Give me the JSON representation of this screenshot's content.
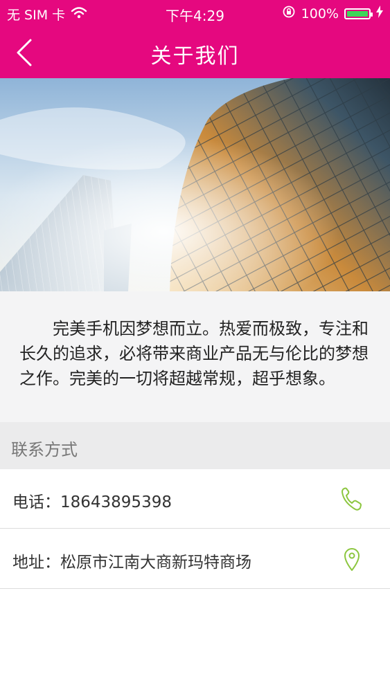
{
  "status_bar": {
    "carrier": "无 SIM 卡",
    "time": "下午4:29",
    "battery": "100%"
  },
  "nav": {
    "title": "关于我们"
  },
  "intro": {
    "text": "完美手机因梦想而立。热爱而极致，专注和长久的追求，必将带来商业产品无与伦比的梦想之作。完美的一切将超越常规，超乎想象。"
  },
  "contact": {
    "section_title": "联系方式",
    "phone_label": "电话：",
    "phone": "18643895398",
    "address_label": "地址：",
    "address": "松原市江南大商新玛特商场"
  },
  "colors": {
    "brand": "#e5087f",
    "icon_accent": "#8cc63f",
    "battery": "#3ed65a"
  },
  "icons": [
    "back-chevron-icon",
    "wifi-icon",
    "orientation-lock-icon",
    "battery-icon",
    "charging-icon",
    "phone-icon",
    "location-pin-icon"
  ]
}
